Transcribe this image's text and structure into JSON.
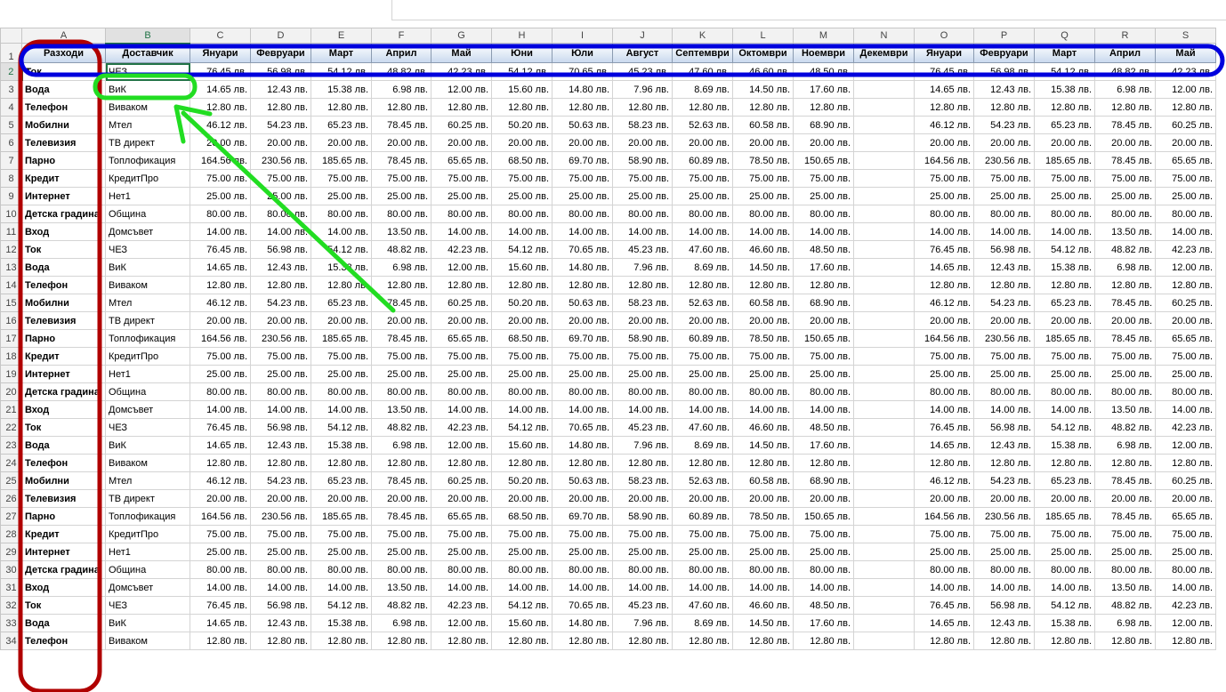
{
  "columns": [
    "A",
    "B",
    "C",
    "D",
    "E",
    "F",
    "G",
    "H",
    "I",
    "J",
    "K",
    "L",
    "M",
    "N",
    "O",
    "P",
    "Q",
    "R",
    "S"
  ],
  "header_row": [
    "Разходи",
    "Доставчик",
    "Януари",
    "Февруари",
    "Март",
    "Април",
    "Май",
    "Юни",
    "Юли",
    "Август",
    "Септември",
    "Октомври",
    "Ноември",
    "Декември",
    "Януари",
    "Февруари",
    "Март",
    "Април",
    "Май"
  ],
  "rows": [
    [
      "Ток",
      "ЧЕЗ",
      "76.45 лв.",
      "56.98 лв.",
      "54.12 лв.",
      "48.82 лв.",
      "42.23 лв.",
      "54.12 лв.",
      "70.65 лв.",
      "45.23 лв.",
      "47.60 лв.",
      "46.60 лв.",
      "48.50 лв.",
      "",
      "76.45 лв.",
      "56.98 лв.",
      "54.12 лв.",
      "48.82 лв.",
      "42.23 лв."
    ],
    [
      "Вода",
      "ВиК",
      "14.65 лв.",
      "12.43 лв.",
      "15.38 лв.",
      "6.98 лв.",
      "12.00 лв.",
      "15.60 лв.",
      "14.80 лв.",
      "7.96 лв.",
      "8.69 лв.",
      "14.50 лв.",
      "17.60 лв.",
      "",
      "14.65 лв.",
      "12.43 лв.",
      "15.38 лв.",
      "6.98 лв.",
      "12.00 лв."
    ],
    [
      "Телефон",
      "Виваком",
      "12.80 лв.",
      "12.80 лв.",
      "12.80 лв.",
      "12.80 лв.",
      "12.80 лв.",
      "12.80 лв.",
      "12.80 лв.",
      "12.80 лв.",
      "12.80 лв.",
      "12.80 лв.",
      "12.80 лв.",
      "",
      "12.80 лв.",
      "12.80 лв.",
      "12.80 лв.",
      "12.80 лв.",
      "12.80 лв."
    ],
    [
      "Мобилни",
      "Мтел",
      "46.12 лв.",
      "54.23 лв.",
      "65.23 лв.",
      "78.45 лв.",
      "60.25 лв.",
      "50.20 лв.",
      "50.63 лв.",
      "58.23 лв.",
      "52.63 лв.",
      "60.58 лв.",
      "68.90 лв.",
      "",
      "46.12 лв.",
      "54.23 лв.",
      "65.23 лв.",
      "78.45 лв.",
      "60.25 лв."
    ],
    [
      "Телевизия",
      "ТВ директ",
      "20.00 лв.",
      "20.00 лв.",
      "20.00 лв.",
      "20.00 лв.",
      "20.00 лв.",
      "20.00 лв.",
      "20.00 лв.",
      "20.00 лв.",
      "20.00 лв.",
      "20.00 лв.",
      "20.00 лв.",
      "",
      "20.00 лв.",
      "20.00 лв.",
      "20.00 лв.",
      "20.00 лв.",
      "20.00 лв."
    ],
    [
      "Парно",
      "Топлофикация",
      "164.56 лв.",
      "230.56 лв.",
      "185.65 лв.",
      "78.45 лв.",
      "65.65 лв.",
      "68.50 лв.",
      "69.70 лв.",
      "58.90 лв.",
      "60.89 лв.",
      "78.50 лв.",
      "150.65 лв.",
      "",
      "164.56 лв.",
      "230.56 лв.",
      "185.65 лв.",
      "78.45 лв.",
      "65.65 лв."
    ],
    [
      "Кредит",
      "КредитПро",
      "75.00 лв.",
      "75.00 лв.",
      "75.00 лв.",
      "75.00 лв.",
      "75.00 лв.",
      "75.00 лв.",
      "75.00 лв.",
      "75.00 лв.",
      "75.00 лв.",
      "75.00 лв.",
      "75.00 лв.",
      "",
      "75.00 лв.",
      "75.00 лв.",
      "75.00 лв.",
      "75.00 лв.",
      "75.00 лв."
    ],
    [
      "Интернет",
      "Нет1",
      "25.00 лв.",
      "25.00 лв.",
      "25.00 лв.",
      "25.00 лв.",
      "25.00 лв.",
      "25.00 лв.",
      "25.00 лв.",
      "25.00 лв.",
      "25.00 лв.",
      "25.00 лв.",
      "25.00 лв.",
      "",
      "25.00 лв.",
      "25.00 лв.",
      "25.00 лв.",
      "25.00 лв.",
      "25.00 лв."
    ],
    [
      "Детска градина",
      "Община",
      "80.00 лв.",
      "80.00 лв.",
      "80.00 лв.",
      "80.00 лв.",
      "80.00 лв.",
      "80.00 лв.",
      "80.00 лв.",
      "80.00 лв.",
      "80.00 лв.",
      "80.00 лв.",
      "80.00 лв.",
      "",
      "80.00 лв.",
      "80.00 лв.",
      "80.00 лв.",
      "80.00 лв.",
      "80.00 лв."
    ],
    [
      "Вход",
      "Домсъвет",
      "14.00 лв.",
      "14.00 лв.",
      "14.00 лв.",
      "13.50 лв.",
      "14.00 лв.",
      "14.00 лв.",
      "14.00 лв.",
      "14.00 лв.",
      "14.00 лв.",
      "14.00 лв.",
      "14.00 лв.",
      "",
      "14.00 лв.",
      "14.00 лв.",
      "14.00 лв.",
      "13.50 лв.",
      "14.00 лв."
    ]
  ],
  "overlays": {
    "red_color": "#b00000",
    "blue_color": "#0000dd",
    "green_color": "#22dd22"
  }
}
